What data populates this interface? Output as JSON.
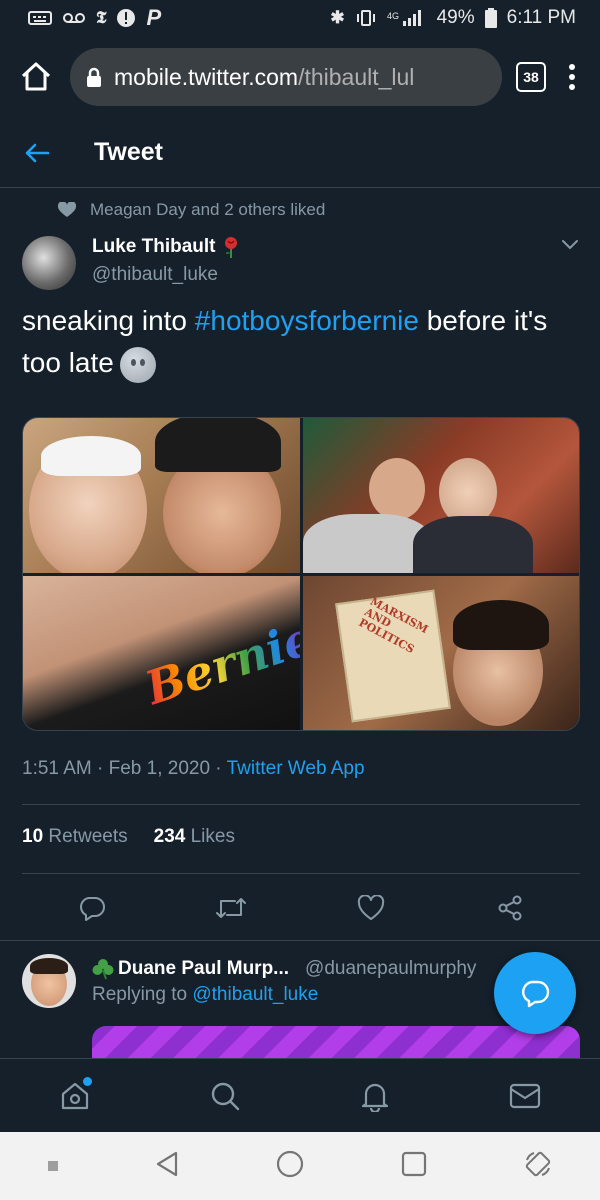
{
  "status_bar": {
    "battery": "49%",
    "time": "6:11 PM"
  },
  "browser": {
    "url_host": "mobile.twitter.com",
    "url_path": "/thibault_lul",
    "tab_count": "38"
  },
  "header": {
    "title": "Tweet"
  },
  "social_context": "Meagan Day and 2 others liked",
  "tweet": {
    "author_name": "Luke Thibault",
    "author_handle": "@thibault_luke",
    "text_before": "sneaking into ",
    "hashtag": "#hotboysforbernie",
    "text_after": " before it's too late",
    "time": "1:51 AM",
    "date": "Feb 1, 2020",
    "app": "Twitter Web App",
    "retweets_count": "10",
    "retweets_label": "Retweets",
    "likes_count": "234",
    "likes_label": "Likes",
    "photo_texts": {
      "shirt": "Bernie",
      "book": "MARXISM AND POLITICS"
    }
  },
  "reply": {
    "name": "Duane Paul Murp...",
    "handle": "@duanepaulmurphy",
    "replying_prefix": "Replying to ",
    "replying_to": "@thibault_luke"
  },
  "colors": {
    "background": "#15202b",
    "accent": "#1da1f2",
    "muted": "#8899a6",
    "divider": "#38444d"
  }
}
